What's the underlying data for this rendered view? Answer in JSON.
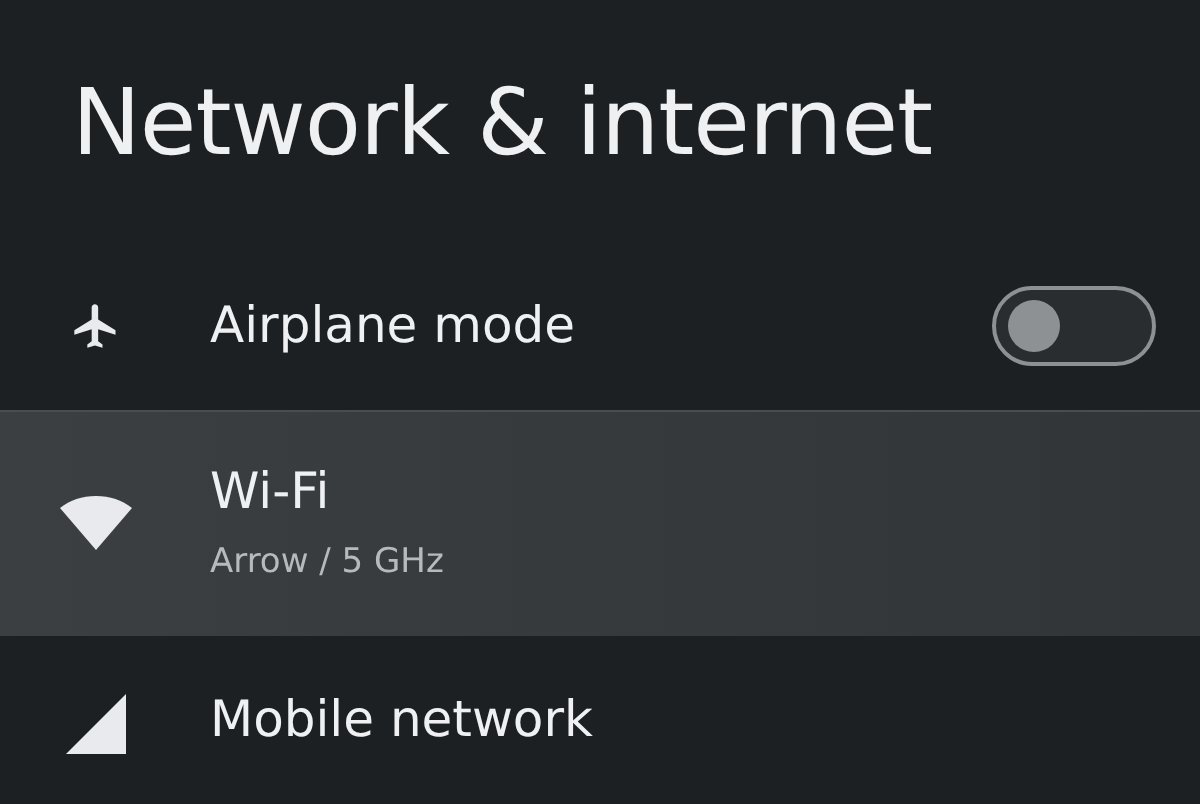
{
  "title": "Network & internet",
  "items": [
    {
      "label": "Airplane mode",
      "kind": "toggle",
      "on": false,
      "selected": false
    },
    {
      "label": "Wi-Fi",
      "subtitle": "Arrow / 5 GHz",
      "kind": "plain",
      "selected": true
    },
    {
      "label": "Mobile network",
      "kind": "plain",
      "selected": false
    }
  ]
}
